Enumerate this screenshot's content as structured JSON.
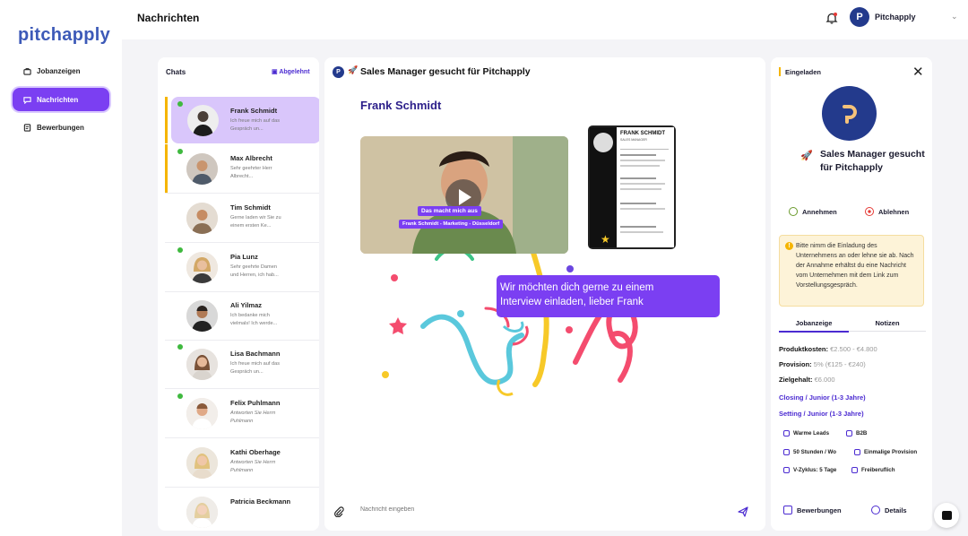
{
  "app": {
    "logo_text": "pitchapply",
    "page_title": "Nachrichten",
    "user_name": "Pitchapply",
    "user_initial": "P"
  },
  "sidebar": {
    "items": [
      {
        "label": "Jobanzeigen",
        "icon": "briefcase-icon"
      },
      {
        "label": "Nachrichten",
        "icon": "message-icon"
      },
      {
        "label": "Bewerbungen",
        "icon": "document-icon"
      }
    ]
  },
  "chats": {
    "title": "Chats",
    "archived_label": "Abgelehnt",
    "items": [
      {
        "name": "Frank Schmidt",
        "preview": "Ich freue mich auf das Gespräch un...",
        "italic": false
      },
      {
        "name": "Max Albrecht",
        "preview": "Sehr geehrter Herr Albrecht...",
        "italic": false
      },
      {
        "name": "Tim Schmidt",
        "preview": "Gerne laden wir Sie zu einem ersten Ke...",
        "italic": false
      },
      {
        "name": "Pia Lunz",
        "preview": "Sehr geehrte Damen und Herren, ich hab...",
        "italic": false
      },
      {
        "name": "Ali Yilmaz",
        "preview": "Ich bedanke mich vielmals! Ich werde...",
        "italic": false
      },
      {
        "name": "Lisa Bachmann",
        "preview": "Ich freue mich auf das Gespräch un...",
        "italic": false
      },
      {
        "name": "Felix Puhlmann",
        "preview": "Antworten Sie Herrn Puhlmann",
        "italic": true
      },
      {
        "name": "Kathi Oberhage",
        "preview": "Antworten Sie Herrn Puhlmann",
        "italic": true
      },
      {
        "name": "Patricia Beckmann",
        "preview": "",
        "italic": false
      }
    ]
  },
  "conversation": {
    "title": "Sales Manager gesucht für Pitchapply",
    "candidate_name": "Frank Schmidt",
    "video_badge": "Das macht mich aus",
    "video_caption": "Frank Schmidt - Marketing - Düsseldorf",
    "cv_name": "FRANK SCHMIDT",
    "cv_subtitle": "SALES MANAGER",
    "message_line1": "Wir möchten dich gerne zu einem",
    "message_line2": "Interview einladen, lieber Frank",
    "input_placeholder": "Nachricht eingeben"
  },
  "details": {
    "status": "Eingeladen",
    "job_title": "Sales Manager gesucht für Pitchapply",
    "accept_label": "Annehmen",
    "reject_label": "Ablehnen",
    "notice": "Bitte nimm die Einladung des Unternehmens an oder lehne sie ab. Nach der Annahme erhältst du eine Nachricht vom Unternehmen mit dem Link zum Vorstellungsgespräch.",
    "tabs": [
      "Jobanzeige",
      "Notizen"
    ],
    "fields": [
      {
        "label": "Produktkosten:",
        "value": "€2.500 - €4.800"
      },
      {
        "label": "Provision:",
        "value": "5% (€125 - €240)"
      },
      {
        "label": "Zielgehalt:",
        "value": "€6.000"
      }
    ],
    "links": [
      "Closing / Junior (1-3 Jahre)",
      "Setting / Junior (1-3 Jahre)"
    ],
    "tags": [
      "Warme Leads",
      "B2B",
      "50 Stunden / Wo",
      "Einmalige Provision",
      "V-Zyklus: 5 Tage",
      "Freiberuflich"
    ],
    "footer_buttons": [
      "Bewerbungen",
      "Details"
    ]
  },
  "colors": {
    "accent": "#7b3ff2",
    "brand": "#233a8c",
    "online": "#3fb93f",
    "highlight": "#f5b500"
  }
}
